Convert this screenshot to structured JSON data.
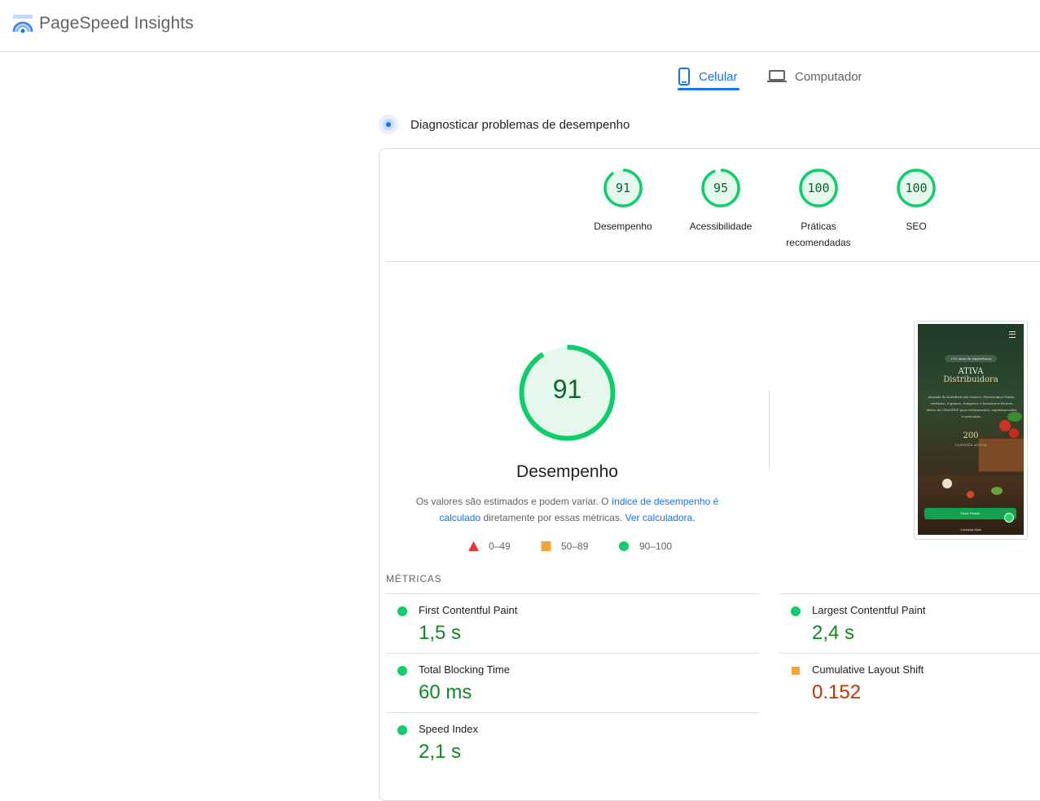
{
  "header": {
    "title": "PageSpeed Insights"
  },
  "tabs": [
    {
      "label": "Celular",
      "active": true,
      "icon": "smartphone-icon"
    },
    {
      "label": "Computador",
      "active": false,
      "icon": "laptop-icon"
    }
  ],
  "diagnose": {
    "title": "Diagnosticar problemas de desempenho"
  },
  "categories": [
    {
      "score": "91",
      "label": "Desempenho",
      "fraction": 0.91
    },
    {
      "score": "95",
      "label": "Acessibilidade",
      "fraction": 0.95
    },
    {
      "score": "100",
      "label_line1": "Práticas",
      "label_line2": "recomendadas",
      "fraction": 1.0
    },
    {
      "score": "100",
      "label": "SEO",
      "fraction": 1.0
    }
  ],
  "performance": {
    "score": "91",
    "fraction": 0.91,
    "label": "Desempenho",
    "desc_prefix": "Os valores são estimados e podem variar. O ",
    "desc_link1": "índice de desempenho é calculado",
    "desc_middle": " diretamente por essas métricas. ",
    "desc_link2": "Ver calculadora."
  },
  "legend": [
    {
      "range": "0–49",
      "shape": "triangle",
      "color": "#e53935"
    },
    {
      "range": "50–89",
      "shape": "square",
      "color": "#f4a533"
    },
    {
      "range": "90–100",
      "shape": "circle",
      "color": "#0cce6b"
    }
  ],
  "screenshot": {
    "badge": "+15 anos de experiência",
    "title_line1": "ATIVA",
    "title_line2": "Distribuidora",
    "text": "atacado de hortifruti em Osasco. Fornecemos frutas, verduras, legumes, temperos e farináceos frescos direto da CEAGESP para restaurantes, supermercados e mercados.",
    "number": "200",
    "caption": "CLIENTES ATIVOS",
    "button": "Fazer Pedido",
    "more": "Conheça Mais"
  },
  "metrics": {
    "title": "MÉTRICAS",
    "items": [
      {
        "name": "First Contentful Paint",
        "value": "1,5 s",
        "rating": "good"
      },
      {
        "name": "Largest Contentful Paint",
        "value": "2,4 s",
        "rating": "good"
      },
      {
        "name": "Total Blocking Time",
        "value": "60 ms",
        "rating": "good"
      },
      {
        "name": "Cumulative Layout Shift",
        "value": "0.152",
        "rating": "average"
      },
      {
        "name": "Speed Index",
        "value": "2,1 s",
        "rating": "good"
      }
    ]
  },
  "colors": {
    "accent": "#1a73e8",
    "pass": "#0cce6b",
    "pass_text": "#0d652d",
    "pass_fill": "#e6f8ed",
    "average": "#f4a533",
    "fail": "#e53935"
  }
}
